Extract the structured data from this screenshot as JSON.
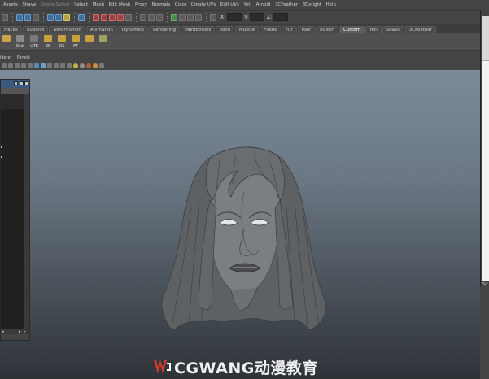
{
  "menu": [
    "Assets",
    "Shave",
    "Shave Select",
    "Select",
    "Mesh",
    "Edit Mesh",
    "Proxy",
    "Normals",
    "Color",
    "Create UVs",
    "Edit UVs",
    "Yeti",
    "Arnold",
    "3CFeather",
    "3Delight",
    "Help"
  ],
  "status_line": {
    "x_label": "X:",
    "y_label": "Y:",
    "z_label": "Z:"
  },
  "shelf_tabs": [
    "rfaces",
    "Subdivs",
    "Deformation",
    "Animation",
    "Dynamics",
    "Rendering",
    "PaintEffects",
    "Toon",
    "Muscle",
    "Fluids",
    "Fur",
    "Hair",
    "nCloth",
    "Custom",
    "Yeti",
    "Shave",
    "3CFeather"
  ],
  "active_shelf_tab": "Custom",
  "shelf_buttons": [
    {
      "label": "",
      "icon": "curve-tool-icon",
      "color": "#c9a24a"
    },
    {
      "label": "Outl",
      "icon": "outliner-icon",
      "color": "#8a8a8a"
    },
    {
      "label": "UTE",
      "icon": "uv-texture-editor-icon",
      "color": "#7a7a7a"
    },
    {
      "label": "ES",
      "icon": "script-folder-icon",
      "color": "#c8a040"
    },
    {
      "label": "OS",
      "icon": "script-folder-icon",
      "color": "#c8a040"
    },
    {
      "label": "FT",
      "icon": "script-folder-icon",
      "color": "#c8a040"
    },
    {
      "label": "",
      "icon": "script-folder-icon",
      "color": "#c8a040"
    },
    {
      "label": "",
      "icon": "paint-tool-icon",
      "color": "#a0a060"
    }
  ],
  "panel_menu": [
    "iderer",
    "Panels"
  ],
  "right_panel": {
    "bottom_text": "5/"
  },
  "watermark": {
    "text": "CGWANG动漫教育",
    "logo_color": "#d23a2a"
  },
  "colors": {
    "viewport_top": "#7d8b99",
    "viewport_bottom": "#2e3338",
    "ui_gray": "#444444",
    "active_tab": "#5e5e5e"
  }
}
